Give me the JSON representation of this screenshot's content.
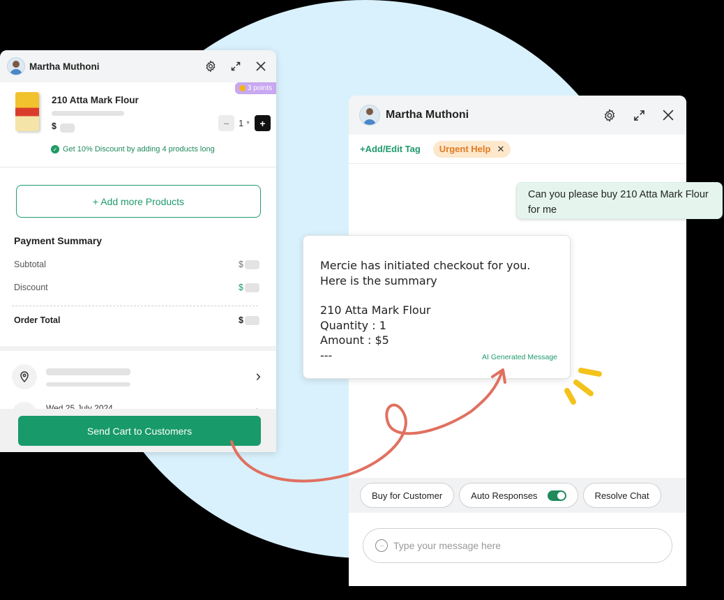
{
  "left_panel": {
    "customer_name": "Martha Muthoni",
    "points_badge": "3 points",
    "product": {
      "name": "210 Atta Mark Flour",
      "currency_symbol": "$",
      "quantity": "1",
      "discount_promo": "Get 10% Discount by adding 4 products long"
    },
    "add_more_label": "+ Add more Products",
    "payment_summary": {
      "title": "Payment Summary",
      "subtotal_label": "Subtotal",
      "discount_label": "Discount",
      "order_total_label": "Order Total",
      "currency_symbol": "$"
    },
    "delivery_date": "Wed 25 July 2024",
    "send_button_label": "Send Cart to Customers"
  },
  "right_panel": {
    "customer_name": "Martha Muthoni",
    "add_tag_label": "+Add/Edit Tag",
    "tag_label": "Urgent Help",
    "actions": {
      "buy_label": "Buy for Customer",
      "auto_responses_label": "Auto Responses",
      "auto_responses_enabled": true,
      "resolve_label": "Resolve Chat"
    },
    "input_placeholder": "Type your message here"
  },
  "messages": {
    "user_message": "Can you please buy 210 Atta Mark Flour for me",
    "summary_line1": "Mercie has initiated checkout for you.",
    "summary_line2": "Here is the summary",
    "summary_item": "210 Atta Mark Flour",
    "summary_quantity": "Quantity : 1",
    "summary_amount": "Amount : $5",
    "summary_end": "---",
    "ai_label": "AI Generated Message"
  },
  "colors": {
    "brand_green": "#189a6b",
    "background_circle": "#d9f1fc",
    "urgent_tag_bg": "#fde8cc",
    "urgent_tag_text": "#e07a22",
    "points_badge": "#c8a8f0",
    "arrow": "#e07060",
    "accent_dashes": "#f4c21c"
  }
}
